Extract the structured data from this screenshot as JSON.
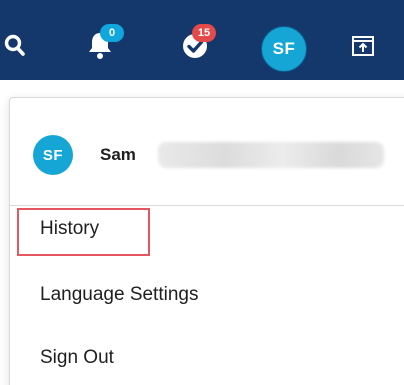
{
  "topbar": {
    "icons": {
      "search": "search-icon",
      "notifications": "bell-icon",
      "tasks": "check-badge-icon",
      "window": "window-icon"
    },
    "notification_count": "0",
    "task_count": "15",
    "avatar_initials": "SF"
  },
  "menu": {
    "avatar_initials": "SF",
    "user_name": "Sam",
    "items": [
      {
        "label": "History",
        "highlighted": true
      },
      {
        "label": "Language Settings"
      },
      {
        "label": "Sign Out"
      }
    ]
  },
  "colors": {
    "topbar": "#14386b",
    "avatar": "#16a6d6",
    "badge_blue": "#12a7dc",
    "badge_red": "#e54a4a",
    "highlight": "#e55662"
  }
}
